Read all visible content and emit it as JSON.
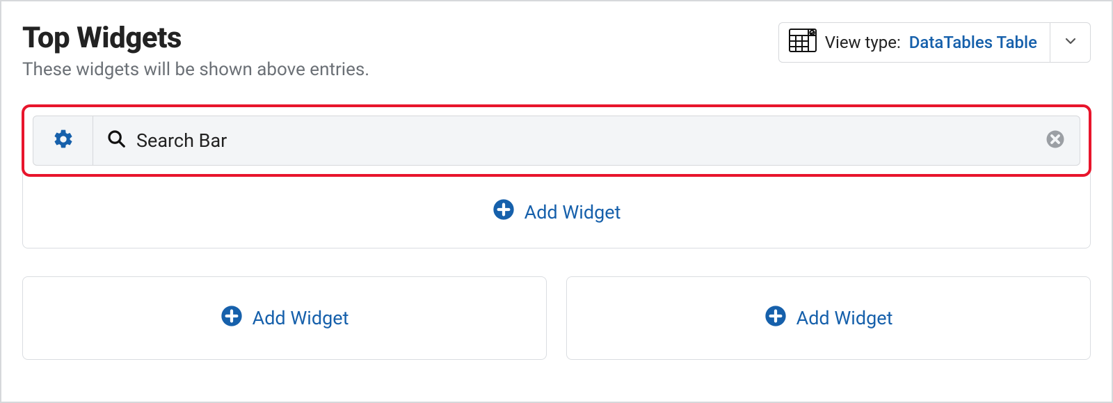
{
  "header": {
    "title": "Top Widgets",
    "subtitle": "These widgets will be shown above entries."
  },
  "view_type": {
    "label": "View type:",
    "value": "DataTables Table"
  },
  "widgets": {
    "search_bar_label": "Search Bar",
    "add_widget_label": "Add Widget"
  },
  "columns": {
    "left_add_label": "Add Widget",
    "right_add_label": "Add Widget"
  },
  "colors": {
    "link": "#1660ab",
    "highlight": "#e8152c",
    "muted": "#6b7076"
  }
}
